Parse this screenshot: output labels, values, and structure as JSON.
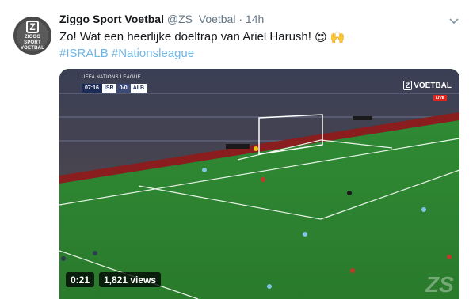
{
  "account": {
    "name": "Ziggo Sport Voetbal",
    "handle": "@ZS_Voetbal",
    "separator": "·",
    "time": "14h",
    "avatar_letter": "Z",
    "avatar_line1": "ZIGGO",
    "avatar_line2": "SPORT",
    "avatar_line3": "VOETBAL"
  },
  "tweet": {
    "text": "Zo! Wat een heerlijke doeltrap van Ariel Harush!",
    "emoji": [
      "😍",
      "🙌"
    ],
    "hashtags": [
      "#ISRALB",
      "#Nationsleague"
    ]
  },
  "video": {
    "league": "UEFA NATIONS LEAGUE",
    "clock": "07:16",
    "home": "ISR",
    "score": "0-0",
    "away": "ALB",
    "brand_letter": "Z",
    "brand_name": "VOETBAL",
    "live_label": "LIVE",
    "duration": "0:21",
    "views": "1,821 views",
    "watermark": "ZS"
  },
  "icons": {
    "menu": "chevron-down-icon",
    "avatar": "ziggo-sport-logo"
  },
  "colors": {
    "link": "#1da1f2",
    "text": "#14171a",
    "muted": "#657786",
    "pitch": "#2e7a2e"
  }
}
